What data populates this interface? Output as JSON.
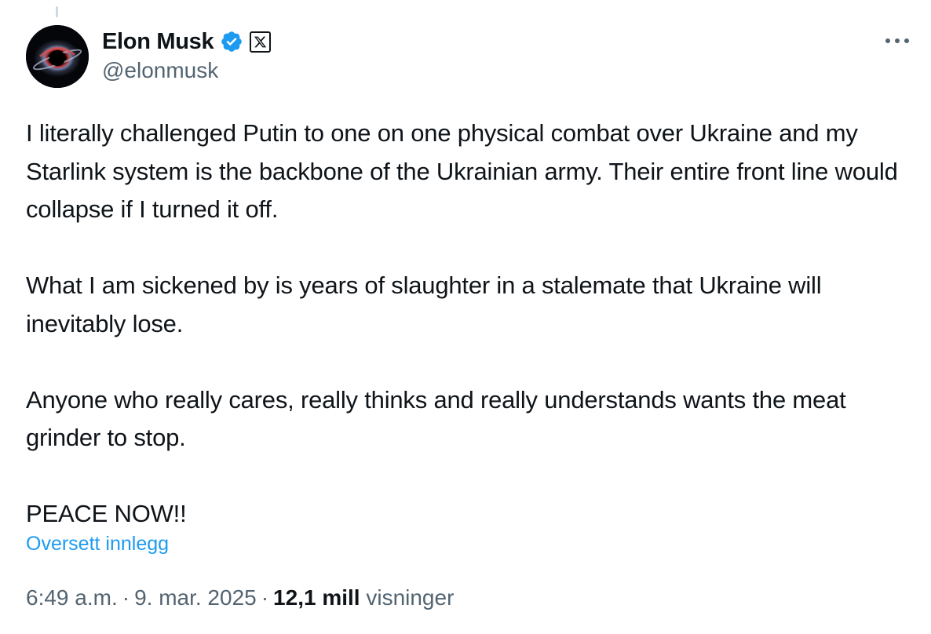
{
  "author": {
    "display_name": "Elon Musk",
    "handle": "@elonmusk",
    "verified": true,
    "affiliate_badge": "X"
  },
  "icons": {
    "verified": "verified-badge-icon",
    "affiliate": "x-logo-icon",
    "more": "more-options-icon",
    "avatar": "black-hole-avatar"
  },
  "colors": {
    "accent": "#1d9bf0",
    "text": "#0f1419",
    "secondary": "#536471"
  },
  "tweet": {
    "paragraphs": [
      "I literally challenged Putin to one on one physical combat over Ukraine and my Starlink system is the backbone of the Ukrainian army. Their entire front line would collapse if I turned it off.",
      "What I am sickened by is years of slaughter in a stalemate that Ukraine will inevitably lose.",
      "Anyone who really cares, really thinks and really understands wants the meat grinder to stop.",
      "PEACE NOW!!"
    ],
    "translate_label": "Oversett innlegg"
  },
  "meta": {
    "time": "6:49 a.m.",
    "separator": "·",
    "date": "9. mar. 2025",
    "views_count": "12,1 mill",
    "views_label": "visninger"
  }
}
